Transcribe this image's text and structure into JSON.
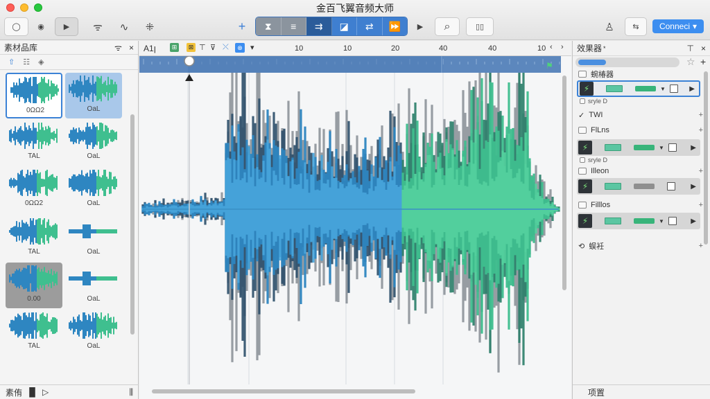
{
  "window": {
    "title": "金百飞翼音频大师"
  },
  "toolbar": {
    "loop_icon": "◯",
    "sphere_icon": "◉",
    "play_icon": "▶",
    "signal_icon": "ᯤ",
    "wave_icon": "∿",
    "snap_icon": "⁜",
    "plus_icon": "+",
    "segment_icons": [
      "⧗",
      "≡",
      "⇉",
      "◪",
      "⇄",
      "⏩"
    ],
    "play2_icon": "▶",
    "search_icon": "⌕",
    "panel_icon": "▯▯",
    "user_icon": "♙",
    "swap_icon": "⇆",
    "connect_label": "Conneci",
    "connect_caret": "▾"
  },
  "library": {
    "title": "素材品库",
    "wifi_icon": "ᯤ",
    "close_icon": "×",
    "tool_icons": [
      "⇧",
      "☷",
      "◈"
    ],
    "clips": [
      {
        "label": "0ΩΩ2"
      },
      {
        "label": "OaL"
      },
      {
        "label": "TAL"
      },
      {
        "label": "OaL"
      },
      {
        "label": "0ΩΩ2"
      },
      {
        "label": "OaL"
      },
      {
        "label": "TAL"
      },
      {
        "label": "OaL"
      },
      {
        "label": "0.00"
      },
      {
        "label": "OaL"
      },
      {
        "label": "TAL"
      },
      {
        "label": "OaL"
      }
    ],
    "footer_label": "素侑",
    "footer_icons": [
      "▐▌",
      "▷",
      "⫼"
    ]
  },
  "editor": {
    "ruler_left": "A1ꞁ",
    "ruler_icons": [
      "⊞",
      "⊠",
      "⊤",
      "⊽",
      "⤬",
      "⊗",
      "▾"
    ],
    "ruler_numbers": [
      "10",
      "10",
      "20",
      "40",
      "40",
      "10"
    ],
    "ruler_arrows": [
      "‹",
      "›"
    ]
  },
  "effects": {
    "title": "效果器",
    "title_mark": "*",
    "pin_icon": "⊤",
    "close_icon": "×",
    "star_icon": "☆",
    "add_icon": "+",
    "plugins": [
      {
        "name": "蜿椿器",
        "selected": true,
        "style": "sryle D",
        "fader": "green"
      },
      {
        "name": "TWI",
        "check": "✓"
      },
      {
        "name": "FlLns",
        "selected": false,
        "style": "sryle D",
        "fader": "green"
      },
      {
        "name": "Illeon",
        "selected": false,
        "fader": "grey"
      },
      {
        "name": "Filllos",
        "selected": false,
        "fader": "green"
      },
      {
        "name": "蜈衽",
        "loop": "⟲"
      }
    ],
    "footer_label": "项置"
  },
  "colors": {
    "accent": "#3d8ef0",
    "wave_blue": "#2e86c1",
    "wave_teal": "#3fbf8f",
    "wave_dark": "#2d4f6b"
  }
}
